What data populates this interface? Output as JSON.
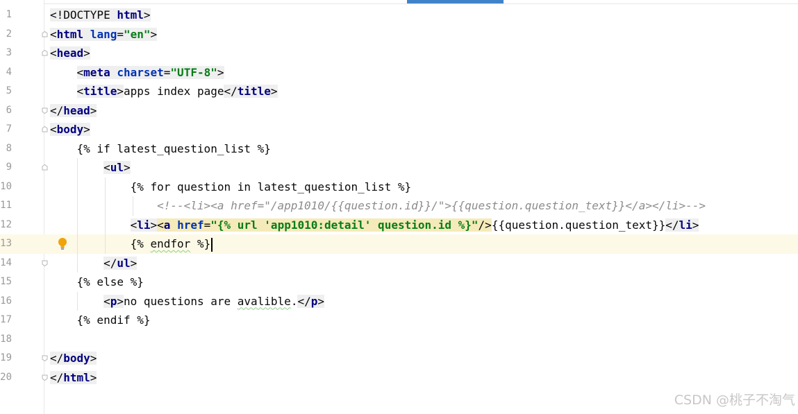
{
  "editor": {
    "line_numbers": [
      "1",
      "2",
      "3",
      "4",
      "5",
      "6",
      "7",
      "8",
      "9",
      "10",
      "11",
      "12",
      "13",
      "14",
      "15",
      "16",
      "17",
      "18",
      "19",
      "20"
    ],
    "l1": {
      "doctype": "<!DOCTYPE ",
      "html": "html",
      "close": ">"
    },
    "l2": {
      "open": "<",
      "tag": "html",
      "sp": " ",
      "attr": "lang",
      "eq": "=",
      "val": "\"en\"",
      "close": ">"
    },
    "l3": {
      "open": "<",
      "tag": "head",
      "close": ">"
    },
    "l4": {
      "indent": "    ",
      "open": "<",
      "tag": "meta",
      "sp": " ",
      "attr": "charset",
      "eq": "=",
      "val": "\"UTF-8\"",
      "close": ">"
    },
    "l5": {
      "indent": "    ",
      "open": "<",
      "tag": "title",
      "close": ">",
      "text": "apps index page",
      "open2": "</",
      "tag2": "title",
      "close2": ">"
    },
    "l6": {
      "open": "</",
      "tag": "head",
      "close": ">"
    },
    "l7": {
      "open": "<",
      "tag": "body",
      "close": ">"
    },
    "l8": {
      "indent": "    ",
      "text": "{% if latest_question_list %}"
    },
    "l9": {
      "indent": "        ",
      "open": "<",
      "tag": "ul",
      "close": ">"
    },
    "l10": {
      "indent": "            ",
      "text": "{% for question in latest_question_list %}"
    },
    "l11": {
      "indent": "                ",
      "text": "<!--<li><a href=\"/app1010/{{question.id}}/\">{{question.question_text}}</a></li>-->"
    },
    "l12": {
      "indent": "            ",
      "li_open": "<",
      "li_tag": "li",
      "li_close": ">",
      "a_open": "<",
      "a_tag": "a",
      "sp": " ",
      "attr": "href",
      "eq": "=",
      "val": "\"{% url 'app1010:detail' question.id %}\"",
      "a_close": "/>",
      "text": "{{question.question_text}}",
      "end_open": "</",
      "end_tag": "li",
      "end_close": ">"
    },
    "l13": {
      "indent": "            ",
      "pre": "{% ",
      "kw": "endfor",
      "post": " %}"
    },
    "l14": {
      "indent": "        ",
      "open": "</",
      "tag": "ul",
      "close": ">"
    },
    "l15": {
      "indent": "    ",
      "text": "{% else %}"
    },
    "l16": {
      "indent": "        ",
      "open": "<",
      "tag": "p",
      "close": ">",
      "text1": "no questions are ",
      "typo": "avalible",
      "text2": ".",
      "open2": "</",
      "tag2": "p",
      "close2": ">"
    },
    "l17": {
      "indent": "    ",
      "text": "{% endif %}"
    },
    "l19": {
      "open": "</",
      "tag": "body",
      "close": ">"
    },
    "l20": {
      "open": "</",
      "tag": "html",
      "close": ">"
    }
  },
  "watermark": "CSDN @桃子不淘气",
  "colors": {
    "tag": "#000080",
    "attr": "#0033b3",
    "value": "#067d17",
    "comment": "#8c8c8c",
    "current_line": "#fdf9e7",
    "tab_indicator": "#4083c9"
  },
  "icons": {
    "gutter_bulb": "lightbulb-icon",
    "fold": "fold-marker-icon"
  }
}
